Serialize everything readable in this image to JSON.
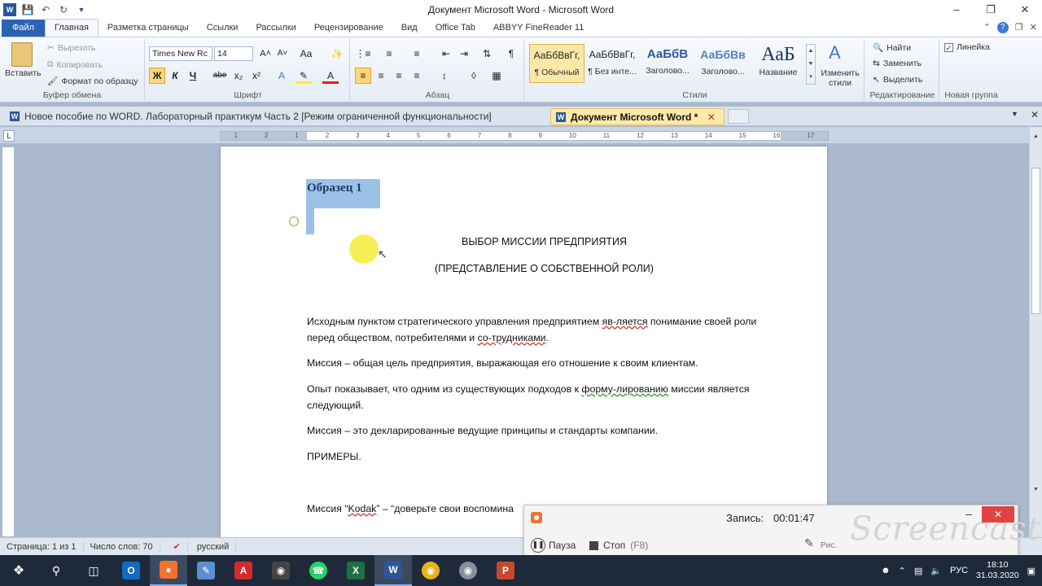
{
  "window": {
    "title": "Документ Microsoft Word  -  Microsoft Word",
    "controls": [
      "–",
      "❐",
      "✕"
    ]
  },
  "qat": {
    "icons": [
      "word-icon",
      "save-icon",
      "undo-icon",
      "redo-icon",
      "customize-icon"
    ]
  },
  "tabs": [
    "Файл",
    "Главная",
    "Разметка страницы",
    "Ссылки",
    "Рассылки",
    "Рецензирование",
    "Вид",
    "Office Tab",
    "ABBYY FineReader 11"
  ],
  "ribbon": {
    "clipboard": {
      "paste": "Вставить",
      "cut": "Вырезать",
      "copy": "Копировать",
      "format_painter": "Формат по образцу",
      "label": "Буфер обмена"
    },
    "font": {
      "name": "Times New Rc",
      "size": "14",
      "label": "Шрифт",
      "bold": "Ж",
      "italic": "К",
      "underline": "Ч",
      "strike": "abe",
      "sub": "x₂",
      "sup": "x²",
      "grow": "A˄",
      "shrink": "A˅",
      "case": "Aa"
    },
    "paragraph": {
      "label": "Абзац"
    },
    "styles": {
      "label": "Стили",
      "items": [
        {
          "sample": "АаБбВвГг,",
          "name": "¶ Обычный"
        },
        {
          "sample": "АаБбВвГг,",
          "name": "¶ Без инте..."
        },
        {
          "sample": "АаБбВ",
          "name": "Заголово..."
        },
        {
          "sample": "АаБбВв",
          "name": "Заголово..."
        },
        {
          "sample": "АаБ",
          "name": "Название"
        }
      ],
      "change": "Изменить стили"
    },
    "editing": {
      "find": "Найти",
      "replace": "Заменить",
      "select": "Выделить",
      "label": "Редактирование"
    },
    "newgroup": {
      "ruler": "Линейка",
      "label": "Новая группа"
    }
  },
  "doc_tabs": [
    {
      "label": "Новое пособие по WORD. Лабораторный практикум Часть 2 [Режим ограниченной функциональности]"
    },
    {
      "label": "Документ Microsoft Word *"
    }
  ],
  "ruler_marks": [
    "1",
    "2",
    "1",
    "2",
    "3",
    "4",
    "5",
    "6",
    "7",
    "8",
    "9",
    "10",
    "11",
    "12",
    "13",
    "14",
    "15",
    "16",
    "17"
  ],
  "document": {
    "heading": "Образец 1",
    "title1": "ВЫБОР МИССИИ ПРЕДПРИЯТИЯ",
    "title2": "(ПРЕДСТАВЛЕНИЕ О СОБСТВЕННОЙ РОЛИ)",
    "p1_a": "Исходным пунктом стратегического управления предприятием ",
    "p1_b": "яв-ляется",
    "p1_c": " понимание своей роли перед обществом, потребителями и ",
    "p1_d": "со-трудниками",
    "p1_e": ".",
    "p2": "Миссия – общая цель предприятия, выражающая его отношение к своим клиентам.",
    "p3_a": "Опыт показывает, что одним из существующих подходов к ",
    "p3_b": "форму-лированию",
    "p3_c": " миссии является следующий.",
    "p4": "Миссия – это декларированные ведущие принципы и стандарты компании.",
    "p5": "ПРИМЕРЫ.",
    "p6_a": "Миссия “",
    "p6_b": "Kodak",
    "p6_c": "” – “доверьте свои воспомина"
  },
  "statusbar": {
    "page": "Страница: 1 из 1",
    "words": "Число слов: 70",
    "lang": "русский"
  },
  "recorder": {
    "label": "Запись:",
    "time": "00:01:47",
    "pause": "Пауза",
    "stop": "Стоп",
    "stop_key": "(F8)",
    "brush_label": "Рис.",
    "watermark": "Screencast"
  },
  "taskbar": {
    "lang": "РУС",
    "time": "18:10",
    "date": "31.03.2020"
  },
  "colors": {
    "file_tab": "#2a63b4",
    "selection": "#9bc2e6",
    "heading": "#1f3864",
    "record_close": "#e04343"
  }
}
